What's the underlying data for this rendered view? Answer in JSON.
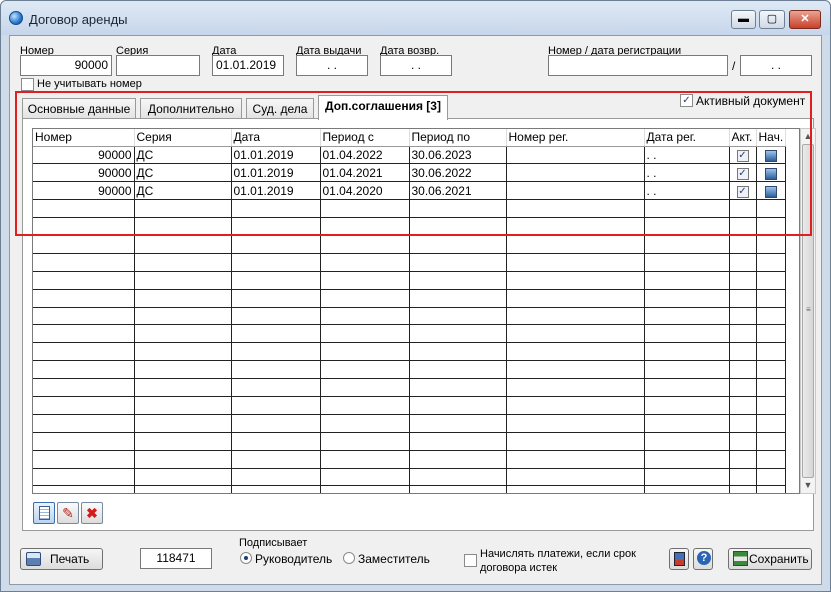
{
  "window": {
    "title": "Договор аренды",
    "min_glyph": "▬",
    "max_glyph": "▢",
    "close_glyph": "✕"
  },
  "header": {
    "nomer_label": "Номер",
    "nomer_value": "90000",
    "seriya_label": "Серия",
    "seriya_value": "",
    "data_label": "Дата",
    "data_value": "01.01.2019",
    "data_vydachi_label": "Дата выдачи",
    "data_vydachi_value": ". .",
    "data_vozvr_label": "Дата возвр.",
    "data_vozvr_value": ". .",
    "reg_label": "Номер / дата регистрации",
    "reg_number_value": "",
    "reg_sep": "/",
    "reg_date_value": ". .",
    "ignore_number_label": "Не учитывать номер"
  },
  "tabs": [
    {
      "label": "Основные данные"
    },
    {
      "label": "Дополнительно"
    },
    {
      "label": "Суд. дела"
    },
    {
      "label": "Доп.соглашения [3]"
    }
  ],
  "active_doc_label": "Активный документ",
  "grid": {
    "columns": [
      "Номер",
      "Серия",
      "Дата",
      "Период с",
      "Период по",
      "Номер рег.",
      "Дата рег.",
      "Акт.",
      "Нач."
    ],
    "rows": [
      {
        "nomer": "90000",
        "seriya": "ДС",
        "data": "01.01.2019",
        "period_s": "01.04.2022",
        "period_po": "30.06.2023",
        "nomer_reg": "",
        "data_reg": ". .",
        "akt": true,
        "nach": true
      },
      {
        "nomer": "90000",
        "seriya": "ДС",
        "data": "01.01.2019",
        "period_s": "01.04.2021",
        "period_po": "30.06.2022",
        "nomer_reg": "",
        "data_reg": ". .",
        "akt": true,
        "nach": true
      },
      {
        "nomer": "90000",
        "seriya": "ДС",
        "data": "01.01.2019",
        "period_s": "01.04.2020",
        "period_po": "30.06.2021",
        "nomer_reg": "",
        "data_reg": ". .",
        "akt": true,
        "nach": true
      }
    ],
    "empty_rows": 17
  },
  "icons": {
    "check": "✓",
    "pencil": "✎",
    "delete": "✖",
    "print": "🖨",
    "help": "?",
    "save": "💾",
    "scroll_up": "▲",
    "scroll_down": "▼",
    "grip": "≡"
  },
  "footer": {
    "print_label": "Печать",
    "doc_id": "118471",
    "signer_label": "Подписывает",
    "signer_head": "Руководитель",
    "signer_deputy": "Заместитель",
    "charge_label": "Начислять платежи, если срок договора истек",
    "save_label": "Сохранить"
  }
}
